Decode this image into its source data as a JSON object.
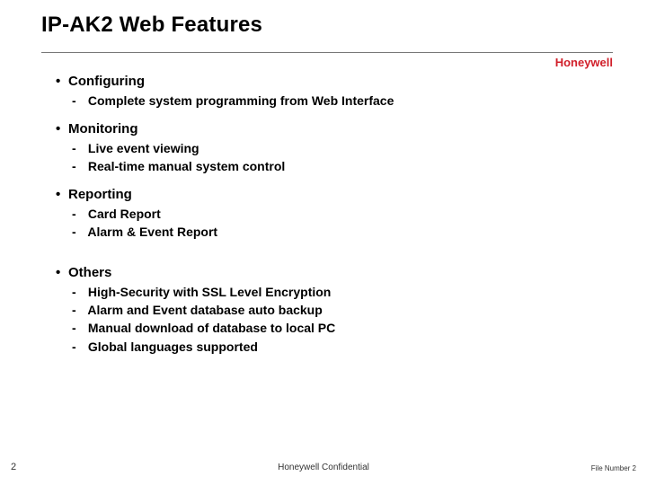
{
  "title": "IP-AK2 Web Features",
  "brand": "Honeywell",
  "brand_color": "#d11f2a",
  "sections": {
    "configuring": {
      "label": "Configuring",
      "items": [
        "Complete system programming from Web Interface"
      ]
    },
    "monitoring": {
      "label": "Monitoring",
      "items": [
        "Live event viewing",
        "Real-time manual system control"
      ]
    },
    "reporting": {
      "label": "Reporting",
      "items": [
        "Card Report",
        "Alarm & Event Report"
      ]
    },
    "others": {
      "label": "Others",
      "items": [
        "High-Security with SSL Level Encryption",
        "Alarm and Event database auto backup",
        "Manual download of database to local PC",
        "Global languages supported"
      ]
    }
  },
  "footer": {
    "page_number": "2",
    "confidentiality": "Honeywell Confidential",
    "file_number": "File Number 2"
  },
  "bullets": {
    "l1": "•",
    "l2": "-"
  }
}
